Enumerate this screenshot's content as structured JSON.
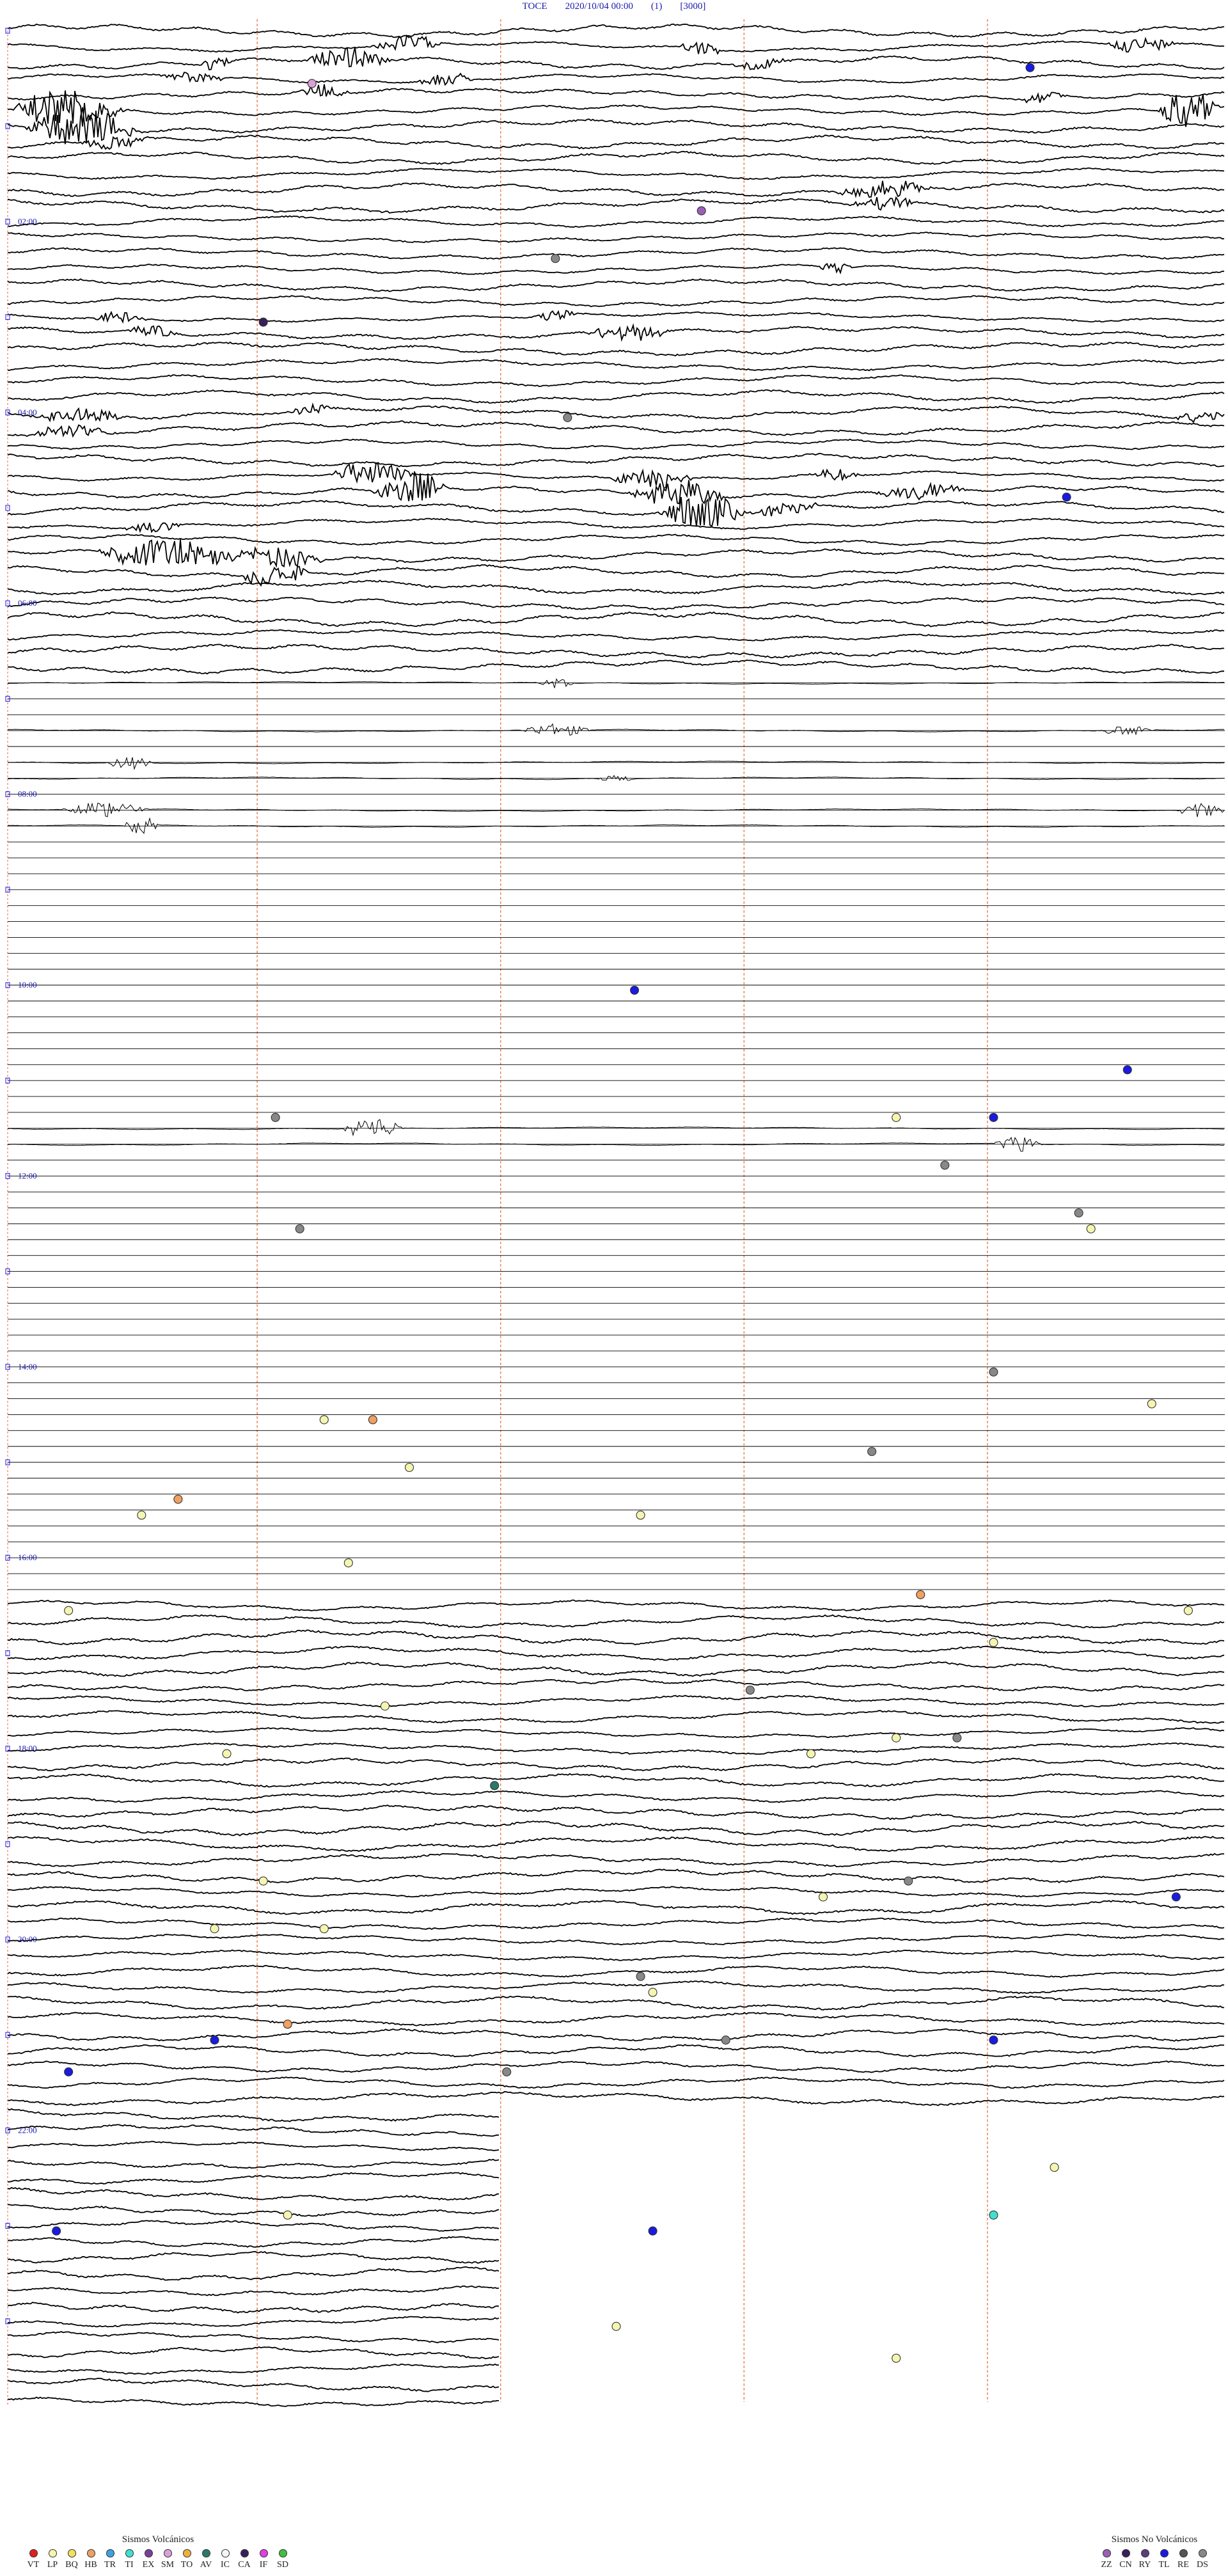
{
  "header": {
    "station": "TOCE",
    "datetime": "2020/10/04 00:00",
    "component": "(1)",
    "scale": "[3000]"
  },
  "chart_data": {
    "type": "helicorder",
    "station": "TOCE",
    "start": "2020/10/04 00:00",
    "hour_labels": [
      "02:00",
      "04:00",
      "06:00",
      "08:00",
      "10:00",
      "12:00",
      "14:00",
      "16:00",
      "18:00",
      "20:00",
      "22:00"
    ],
    "rows": 96,
    "minutes_per_row": 15,
    "events": [
      {
        "row": 1,
        "t": 0.84,
        "color": "#1a1ae0"
      },
      {
        "row": 2,
        "t": 0.25,
        "color": "#d9a0d9"
      },
      {
        "row": 7,
        "t": 0.57,
        "color": "#9b5fb7"
      },
      {
        "row": 9,
        "t": 0.45,
        "color": "#888888"
      },
      {
        "row": 12,
        "t": 0.21,
        "color": "#3a1f5a"
      },
      {
        "row": 16,
        "t": 0.46,
        "color": "#888888"
      },
      {
        "row": 19,
        "t": 0.87,
        "color": "#1a1ae0"
      },
      {
        "row": 40,
        "t": 0.515,
        "color": "#1a1ae0"
      },
      {
        "row": 43,
        "t": 0.92,
        "color": "#1a1ae0"
      },
      {
        "row": 45,
        "t": 0.22,
        "color": "#888888"
      },
      {
        "row": 45,
        "t": 0.73,
        "color": "#f5f5b0"
      },
      {
        "row": 45,
        "t": 0.81,
        "color": "#1a1ae0"
      },
      {
        "row": 47,
        "t": 0.77,
        "color": "#888888"
      },
      {
        "row": 49,
        "t": 0.88,
        "color": "#888888"
      },
      {
        "row": 50,
        "t": 0.24,
        "color": "#888888"
      },
      {
        "row": 50,
        "t": 0.89,
        "color": "#f5f5b0"
      },
      {
        "row": 56,
        "t": 0.81,
        "color": "#888888"
      },
      {
        "row": 57,
        "t": 0.94,
        "color": "#f5f5b0"
      },
      {
        "row": 58,
        "t": 0.26,
        "color": "#f5f5b0"
      },
      {
        "row": 58,
        "t": 0.3,
        "color": "#f0a060"
      },
      {
        "row": 59,
        "t": 0.71,
        "color": "#888888"
      },
      {
        "row": 60,
        "t": 0.33,
        "color": "#f5f5b0"
      },
      {
        "row": 61,
        "t": 0.14,
        "color": "#f0a060"
      },
      {
        "row": 62,
        "t": 0.11,
        "color": "#f5f5b0"
      },
      {
        "row": 62,
        "t": 0.52,
        "color": "#f5f5b0"
      },
      {
        "row": 64,
        "t": 0.28,
        "color": "#f5f5b0"
      },
      {
        "row": 65,
        "t": 0.75,
        "color": "#f0a060"
      },
      {
        "row": 66,
        "t": 0.05,
        "color": "#f5f5b0"
      },
      {
        "row": 66,
        "t": 0.97,
        "color": "#f5f5b0"
      },
      {
        "row": 67,
        "t": 0.81,
        "color": "#f5f5b0"
      },
      {
        "row": 69,
        "t": 0.61,
        "color": "#888888"
      },
      {
        "row": 70,
        "t": 0.31,
        "color": "#f5f5b0"
      },
      {
        "row": 71,
        "t": 0.78,
        "color": "#888888"
      },
      {
        "row": 71,
        "t": 0.73,
        "color": "#f5f5b0"
      },
      {
        "row": 72,
        "t": 0.66,
        "color": "#f5f5b0"
      },
      {
        "row": 72,
        "t": 0.18,
        "color": "#f5f5b0"
      },
      {
        "row": 73,
        "t": 0.4,
        "color": "#2a7a6a"
      },
      {
        "row": 77,
        "t": 0.21,
        "color": "#f5f5b0"
      },
      {
        "row": 77,
        "t": 0.74,
        "color": "#888888"
      },
      {
        "row": 78,
        "t": 0.67,
        "color": "#f5f5b0"
      },
      {
        "row": 78,
        "t": 0.96,
        "color": "#1a1ae0"
      },
      {
        "row": 79,
        "t": 0.26,
        "color": "#f5f5b0"
      },
      {
        "row": 79,
        "t": 0.17,
        "color": "#f5f5b0"
      },
      {
        "row": 81,
        "t": 0.52,
        "color": "#888888"
      },
      {
        "row": 82,
        "t": 0.53,
        "color": "#f5f5b0"
      },
      {
        "row": 83,
        "t": 0.23,
        "color": "#f0a060"
      },
      {
        "row": 84,
        "t": 0.59,
        "color": "#888888"
      },
      {
        "row": 84,
        "t": 0.17,
        "color": "#1a1ae0"
      },
      {
        "row": 84,
        "t": 0.81,
        "color": "#1a1ae0"
      },
      {
        "row": 85,
        "t": 0.41,
        "color": "#888888"
      },
      {
        "row": 85,
        "t": 0.05,
        "color": "#1a1ae0"
      },
      {
        "row": 89,
        "t": 0.86,
        "color": "#f5f5b0"
      },
      {
        "row": 91,
        "t": 0.23,
        "color": "#f5f5b0"
      },
      {
        "row": 91,
        "t": 0.81,
        "color": "#40e0d0"
      },
      {
        "row": 92,
        "t": 0.04,
        "color": "#1a1ae0"
      },
      {
        "row": 92,
        "t": 0.53,
        "color": "#1a1ae0"
      },
      {
        "row": 96,
        "t": 0.5,
        "color": "#f5f5b0"
      },
      {
        "row": 97,
        "t": 0.73,
        "color": "#f5f5b0"
      }
    ]
  },
  "legend_volcanic": {
    "title": "Sismos Volcánicos",
    "items": [
      {
        "code": "VT",
        "color": "#e02020"
      },
      {
        "code": "LP",
        "color": "#f5f5b0"
      },
      {
        "code": "BQ",
        "color": "#f5e060"
      },
      {
        "code": "HB",
        "color": "#f0a060"
      },
      {
        "code": "TR",
        "color": "#40a0e0"
      },
      {
        "code": "TI",
        "color": "#40e0d0"
      },
      {
        "code": "EX",
        "color": "#7a3f9a"
      },
      {
        "code": "SM",
        "color": "#d9a0d9"
      },
      {
        "code": "TO",
        "color": "#f0b040"
      },
      {
        "code": "AV",
        "color": "#2a7a6a"
      },
      {
        "code": "IC",
        "color": "#f5f5f5"
      },
      {
        "code": "CA",
        "color": "#3a1f5a"
      },
      {
        "code": "IF",
        "color": "#e040e0"
      },
      {
        "code": "SD",
        "color": "#40c040"
      }
    ]
  },
  "legend_nonvolcanic": {
    "title": "Sismos No Volcánicos",
    "items": [
      {
        "code": "ZZ",
        "color": "#9b5fb7"
      },
      {
        "code": "CN",
        "color": "#3a1f5a"
      },
      {
        "code": "RY",
        "color": "#5a3f7a"
      },
      {
        "code": "TL",
        "color": "#1a1ae0"
      },
      {
        "code": "RE",
        "color": "#555555"
      },
      {
        "code": "DS",
        "color": "#888888"
      }
    ]
  }
}
